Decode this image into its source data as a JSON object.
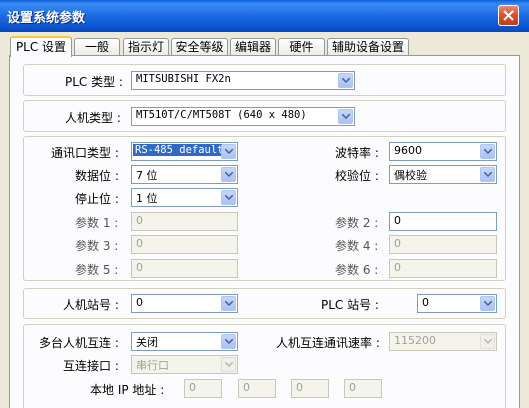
{
  "window": {
    "title": "设置系统参数"
  },
  "tabs": [
    {
      "label": "PLC 设置",
      "active": true
    },
    {
      "label": "一般"
    },
    {
      "label": "指示灯"
    },
    {
      "label": "安全等级"
    },
    {
      "label": "编辑器"
    },
    {
      "label": "硬件"
    },
    {
      "label": "辅助设备设置"
    }
  ],
  "plc_type": {
    "label": "PLC 类型 :",
    "value": "MITSUBISHI FX2n"
  },
  "hmi_type": {
    "label": "人机类型 :",
    "value": "MT510T/C/MT508T (640 x 480)"
  },
  "comm": {
    "port_type": {
      "label": "通讯口类型 :",
      "value": "RS-485 default"
    },
    "data_bits": {
      "label": "数据位 :",
      "value": "7 位"
    },
    "stop_bits": {
      "label": "停止位 :",
      "value": "1 位"
    },
    "baud_rate": {
      "label": "波特率 :",
      "value": "9600"
    },
    "parity": {
      "label": "校验位 :",
      "value": "偶校验"
    },
    "param1": {
      "label": "参数 1 :",
      "value": "0"
    },
    "param2": {
      "label": "参数 2 :",
      "value": "0"
    },
    "param3": {
      "label": "参数 3 :",
      "value": "0"
    },
    "param4": {
      "label": "参数 4 :",
      "value": "0"
    },
    "param5": {
      "label": "参数 5 :",
      "value": "0"
    },
    "param6": {
      "label": "参数 6 :",
      "value": "0"
    }
  },
  "stations": {
    "hmi_station": {
      "label": "人机站号 :",
      "value": "0"
    },
    "plc_station": {
      "label": "PLC 站号 :",
      "value": "0"
    }
  },
  "multi": {
    "interconnect": {
      "label": "多台人机互连 :",
      "value": "关闭"
    },
    "rate": {
      "label": "人机互连通讯速率 :",
      "value": "115200"
    },
    "interface": {
      "label": "互连接口 :",
      "value": "串行口"
    },
    "local_ip": {
      "label": "本地 IP 地址 :",
      "octets": [
        "0",
        "0",
        "0",
        "0"
      ]
    }
  }
}
